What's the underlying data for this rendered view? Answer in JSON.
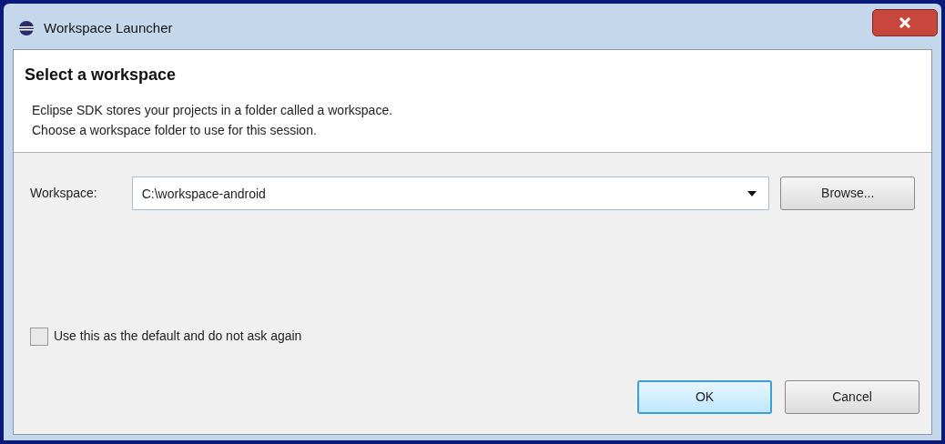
{
  "window": {
    "title": "Workspace Launcher"
  },
  "header": {
    "title": "Select a workspace",
    "description": "Eclipse SDK stores your projects in a folder called a workspace.\nChoose a workspace folder to use for this session."
  },
  "workspace": {
    "label": "Workspace:",
    "value": "C:\\workspace-android",
    "browse_button": "Browse..."
  },
  "default_checkbox": {
    "label": "Use this as the default and do not ask again",
    "checked": false
  },
  "buttons": [
    {
      "label": "OK",
      "default": true
    },
    {
      "label": "Cancel",
      "default": false
    }
  ]
}
